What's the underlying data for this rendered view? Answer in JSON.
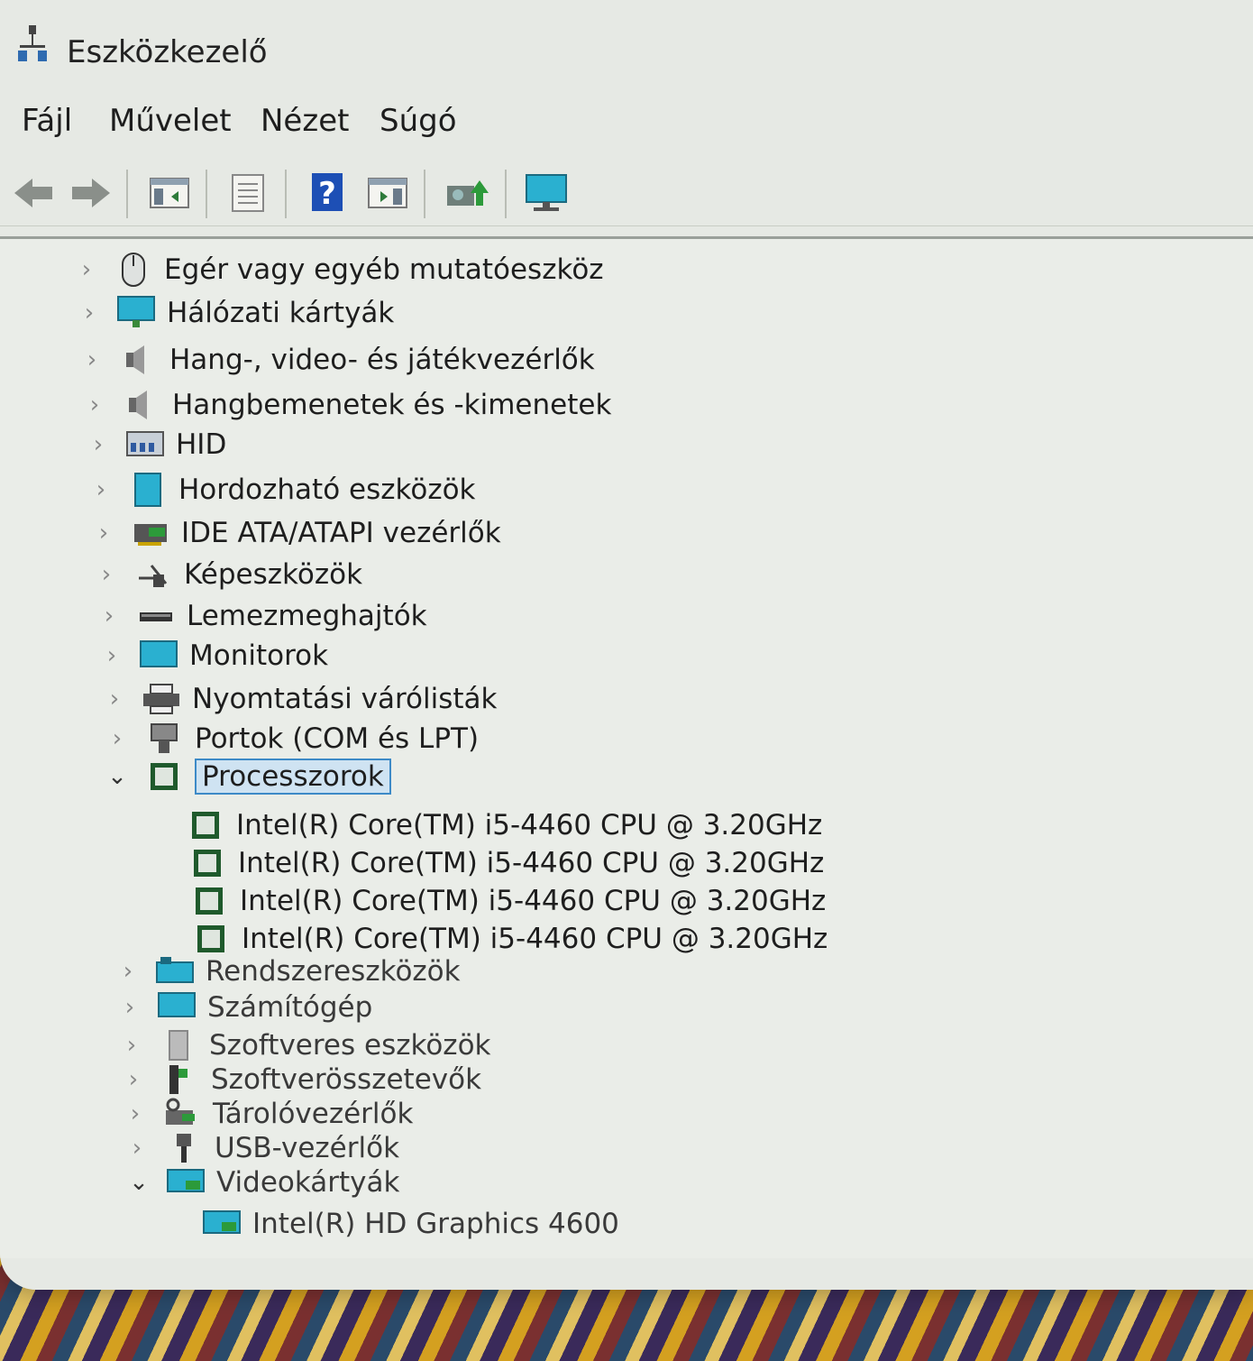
{
  "window": {
    "title": "Eszközkezelő"
  },
  "menu": [
    "Fájl",
    "Művelet",
    "Nézet",
    "Súgó"
  ],
  "toolbar": {
    "icons": [
      "back-arrow-icon",
      "forward-arrow-icon",
      "show-hide-console-tree-icon",
      "properties-icon",
      "help-icon",
      "action-pane-icon",
      "update-driver-icon",
      "scan-hardware-icon"
    ]
  },
  "tree": {
    "categories": [
      {
        "label": "Egér vagy egyéb mutatóeszköz",
        "icon": "mouse-icon",
        "expanded": false
      },
      {
        "label": "Hálózati kártyák",
        "icon": "network-adapter-icon",
        "expanded": false
      },
      {
        "label": "Hang-, video- és játékvezérlők",
        "icon": "speaker-icon",
        "expanded": false
      },
      {
        "label": "Hangbemenetek és -kimenetek",
        "icon": "audio-io-icon",
        "expanded": false
      },
      {
        "label": "HID",
        "icon": "hid-icon",
        "expanded": false
      },
      {
        "label": "Hordozható eszközök",
        "icon": "portable-device-icon",
        "expanded": false
      },
      {
        "label": "IDE ATA/ATAPI vezérlők",
        "icon": "ide-controller-icon",
        "expanded": false
      },
      {
        "label": "Képeszközök",
        "icon": "camera-icon",
        "expanded": false
      },
      {
        "label": "Lemezmeghajtók",
        "icon": "disk-drive-icon",
        "expanded": false
      },
      {
        "label": "Monitorok",
        "icon": "monitor-icon",
        "expanded": false
      },
      {
        "label": "Nyomtatási várólisták",
        "icon": "printer-icon",
        "expanded": false
      },
      {
        "label": "Portok (COM és LPT)",
        "icon": "port-icon",
        "expanded": false
      },
      {
        "label": "Processzorok",
        "icon": "processor-icon",
        "expanded": true,
        "selected": true,
        "children": [
          "Intel(R) Core(TM) i5-4460  CPU @ 3.20GHz",
          "Intel(R) Core(TM) i5-4460  CPU @ 3.20GHz",
          "Intel(R) Core(TM) i5-4460  CPU @ 3.20GHz",
          "Intel(R) Core(TM) i5-4460  CPU @ 3.20GHz"
        ]
      },
      {
        "label": "Rendszereszközök",
        "icon": "system-devices-icon",
        "expanded": false
      },
      {
        "label": "Számítógép",
        "icon": "computer-icon",
        "expanded": false
      },
      {
        "label": "Szoftveres eszközök",
        "icon": "software-device-icon",
        "expanded": false
      },
      {
        "label": "Szoftverösszetevők",
        "icon": "software-component-icon",
        "expanded": false
      },
      {
        "label": "Tárolóvezérlők",
        "icon": "storage-controller-icon",
        "expanded": false
      },
      {
        "label": "USB-vezérlők",
        "icon": "usb-icon",
        "expanded": false
      },
      {
        "label": "Videokártyák",
        "icon": "display-adapter-icon",
        "expanded": true,
        "children": [
          "Intel(R) HD Graphics 4600"
        ]
      }
    ]
  },
  "colors": {
    "selection_border": "#3d8ac7",
    "selection_bg": "#cfe3f2",
    "window_bg": "#e6e9e4"
  }
}
